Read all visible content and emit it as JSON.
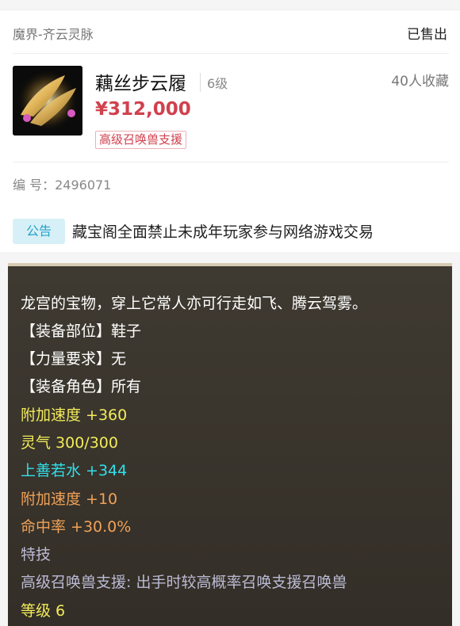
{
  "colors": {
    "price_red": "#d0414e",
    "notice_blue": "#23a2c6",
    "desc_white": "#ffffff",
    "desc_yellow": "#f3ec5a",
    "desc_cyan": "#2fe0ea",
    "desc_orange": "#f0a258",
    "desc_gray": "#bcbbd5"
  },
  "listing": {
    "server": "魔界-齐云灵脉",
    "status": "已售出",
    "item_name": "藕丝步云履",
    "level": "6级",
    "favorites": "40人收藏",
    "price": "¥312,000",
    "tag": "高级召唤兽支援",
    "id_label": "编  号：",
    "id_value": "2496071",
    "thumbnail_icon": "golden-wing-shoes-icon"
  },
  "notice": {
    "badge": "公告",
    "text": "藏宝阁全面禁止未成年玩家参与网络游戏交易"
  },
  "description": {
    "lines": [
      "龙宫的宝物，穿上它常人亦可行走如飞、腾云驾雾。",
      "【装备部位】鞋子",
      "【力量要求】无",
      "【装备角色】所有",
      "附加速度 +360",
      "灵气 300/300",
      "上善若水 +344",
      "附加速度 +10",
      "命中率 +30.0%",
      "特技",
      "高级召唤兽支援: 出手时较高概率召唤支援召唤兽",
      "等级 6"
    ]
  }
}
